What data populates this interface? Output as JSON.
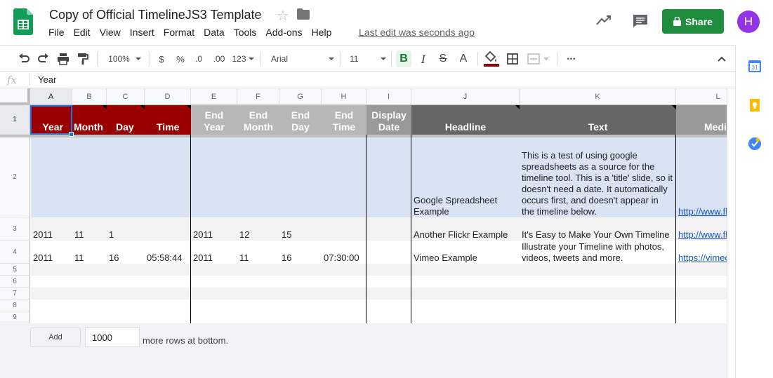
{
  "header": {
    "title": "Copy of Official TimelineJS3 Template",
    "menu": [
      "File",
      "Edit",
      "View",
      "Insert",
      "Format",
      "Data",
      "Tools",
      "Add-ons",
      "Help"
    ],
    "last_edit": "Last edit was seconds ago",
    "share_label": "Share",
    "avatar_initial": "H"
  },
  "toolbar": {
    "zoom": "100%",
    "currency": "$",
    "percent": "%",
    "decrease_decimal": ".0",
    "increase_decimal": ".00",
    "number_format": "123",
    "font": "Arial",
    "font_size": "11",
    "bold": "B",
    "italic": "I",
    "strike": "S",
    "text_color": "A",
    "more": "•••"
  },
  "formula_bar": {
    "fx": "fx",
    "value": "Year"
  },
  "columns": [
    "A",
    "B",
    "C",
    "D",
    "E",
    "F",
    "G",
    "H",
    "I",
    "J",
    "K",
    "L"
  ],
  "rows": [
    "1",
    "2",
    "3",
    "4",
    "5",
    "6",
    "7",
    "8",
    "9"
  ],
  "header_row": {
    "a": "Year",
    "b": "Month",
    "c": "Day",
    "d": "Time",
    "e1": "End",
    "e2": "Year",
    "f1": "End",
    "f2": "Month",
    "g1": "End",
    "g2": "Day",
    "h1": "End",
    "h2": "Time",
    "i1": "Display",
    "i2": "Date",
    "j": "Headline",
    "k": "Text",
    "l": "Medi"
  },
  "row2": {
    "headline_1": "Google Spreadsheet",
    "headline_2": "Example",
    "text_lines": [
      "This is a test of using google",
      "spreadsheets as a source for the",
      "timeline tool. This is a 'title' slide, so it",
      "doesn't need a date. It automatically",
      "occurs first, and doesn't appear in",
      "the timeline below."
    ],
    "media": "http://www.fli"
  },
  "row3": {
    "year": "2011",
    "month": "11",
    "day": "1",
    "end_year": "2011",
    "end_month": "12",
    "end_day": "15",
    "headline": "Another Flickr Example",
    "text": "It's Easy to Make Your Own Timeline",
    "media": "http://www.fli"
  },
  "row4": {
    "year": "2011",
    "month": "11",
    "day": "16",
    "time": "05:58:44",
    "end_year": "2011",
    "end_month": "11",
    "end_day": "16",
    "end_time": "07:30:00",
    "headline": "Vimeo Example",
    "text_1": "Illustrate your Timeline with photos,",
    "text_2": "videos, tweets and more.",
    "media": "https://vimeo"
  },
  "footer": {
    "add_label": "Add",
    "rows_value": "1000",
    "more_rows": "more rows at bottom."
  },
  "colors": {
    "date_header": "#990000",
    "end_header": "#b7b7b7",
    "dark_header": "#666666",
    "media_header": "#999999",
    "row2_fill": "#dae3f3",
    "share": "#1e8e3e",
    "avatar": "#9334e6"
  }
}
